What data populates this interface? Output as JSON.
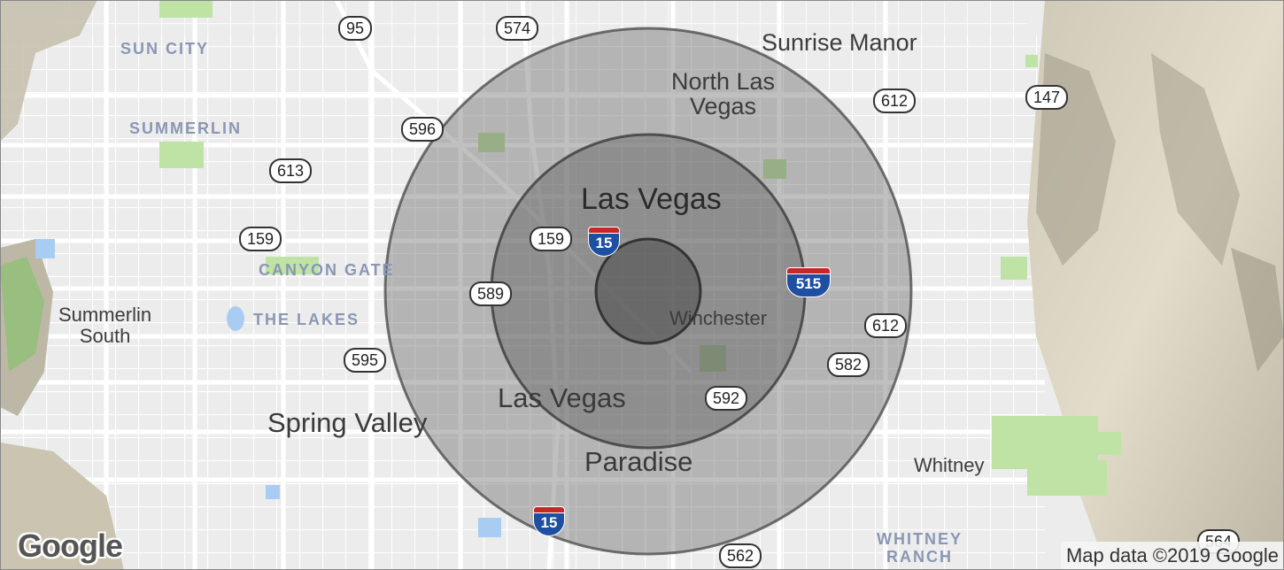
{
  "map": {
    "labels": {
      "las_vegas_main": "Las Vegas",
      "las_vegas_south": "Las Vegas",
      "sunrise_manor": "Sunrise Manor",
      "north_las_vegas": "North Las\nVegas",
      "winchester": "Winchester",
      "spring_valley": "Spring Valley",
      "paradise": "Paradise",
      "whitney": "Whitney",
      "summerlin_south": "Summerlin\nSouth",
      "sun_city": "SUN CITY",
      "summerlin": "SUMMERLIN",
      "canyon_gate": "CANYON GATE",
      "the_lakes": "THE LAKES",
      "whitney_ranch": "WHITNEY\nRANCH"
    },
    "route_shields": [
      "95",
      "574",
      "596",
      "613",
      "159",
      "159",
      "589",
      "595",
      "612",
      "612",
      "147",
      "582",
      "592",
      "562",
      "564"
    ],
    "interstate_shields": [
      "15",
      "515",
      "15"
    ],
    "radius_rings": 3,
    "ring_fill": "#5a5a5a",
    "ring_stroke": "#3d3d3d"
  },
  "branding": {
    "logo": "Google",
    "attribution": "Map data ©2019 Google"
  }
}
